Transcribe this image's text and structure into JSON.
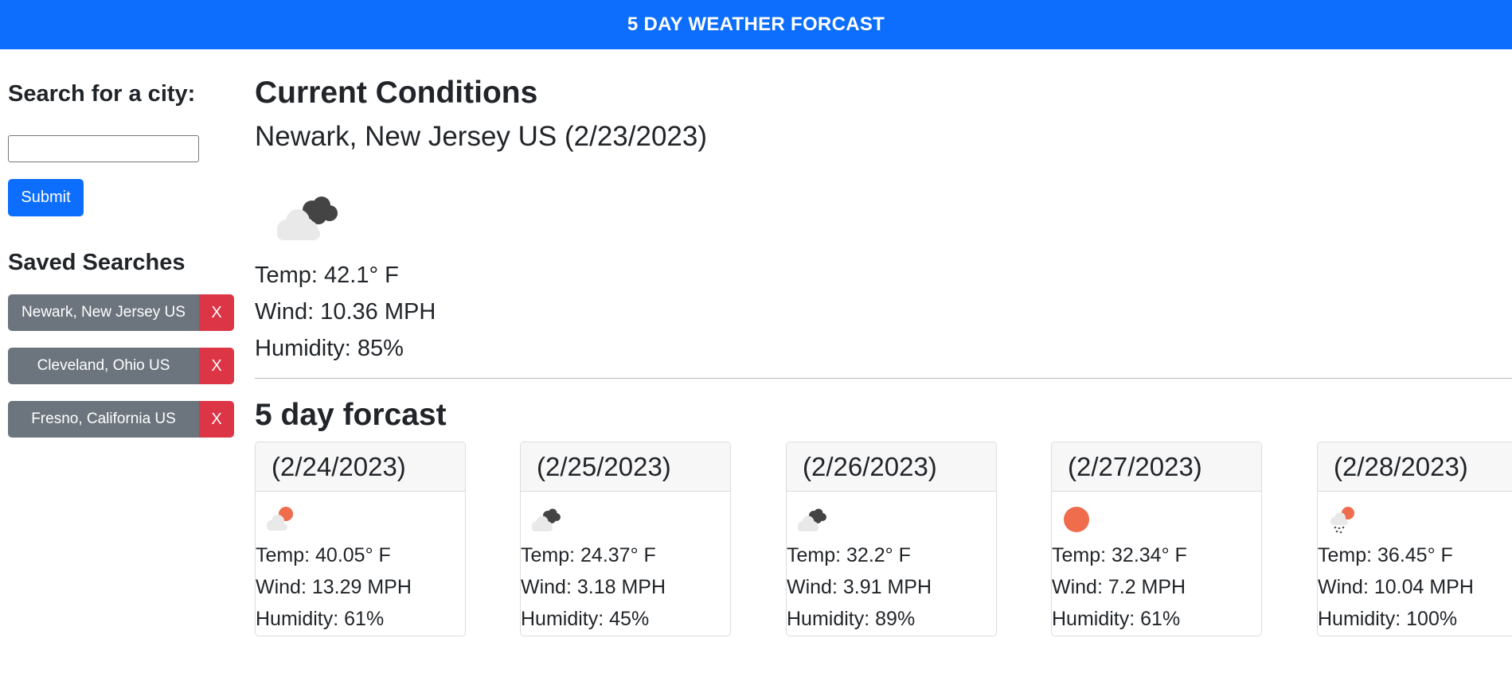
{
  "header": {
    "title": "5 DAY WEATHER FORCAST"
  },
  "search": {
    "label": "Search for a city:",
    "value": "",
    "placeholder": "",
    "submit_label": "Submit"
  },
  "saved": {
    "title": "Saved Searches",
    "items": [
      {
        "city": "Newark, New Jersey US",
        "delete_label": "X"
      },
      {
        "city": "Cleveland, Ohio US",
        "delete_label": "X"
      },
      {
        "city": "Fresno, California US",
        "delete_label": "X"
      }
    ]
  },
  "current": {
    "title": "Current Conditions",
    "city_date": "Newark, New Jersey US (2/23/2023)",
    "icon": "broken-clouds-icon",
    "temp": "Temp: 42.1° F",
    "wind": "Wind: 10.36 MPH",
    "humidity": "Humidity: 85%"
  },
  "forecast": {
    "title": "5 day forcast",
    "days": [
      {
        "date": "(2/24/2023)",
        "icon": "few-clouds-icon",
        "temp": "Temp: 40.05° F",
        "wind": "Wind: 13.29 MPH",
        "humidity": "Humidity: 61%"
      },
      {
        "date": "(2/25/2023)",
        "icon": "broken-clouds-icon",
        "temp": "Temp: 24.37° F",
        "wind": "Wind: 3.18 MPH",
        "humidity": "Humidity: 45%"
      },
      {
        "date": "(2/26/2023)",
        "icon": "broken-clouds-icon",
        "temp": "Temp: 32.2° F",
        "wind": "Wind: 3.91 MPH",
        "humidity": "Humidity: 89%"
      },
      {
        "date": "(2/27/2023)",
        "icon": "clear-sky-icon",
        "temp": "Temp: 32.34° F",
        "wind": "Wind: 7.2 MPH",
        "humidity": "Humidity: 61%"
      },
      {
        "date": "(2/28/2023)",
        "icon": "rain-icon",
        "temp": "Temp: 36.45° F",
        "wind": "Wind: 10.04 MPH",
        "humidity": "Humidity: 100%"
      }
    ]
  },
  "colors": {
    "header_bg": "#0d6efd",
    "primary": "#0d6efd",
    "secondary": "#6c757d",
    "danger": "#dc3545",
    "sun": "#ef6c4c"
  }
}
